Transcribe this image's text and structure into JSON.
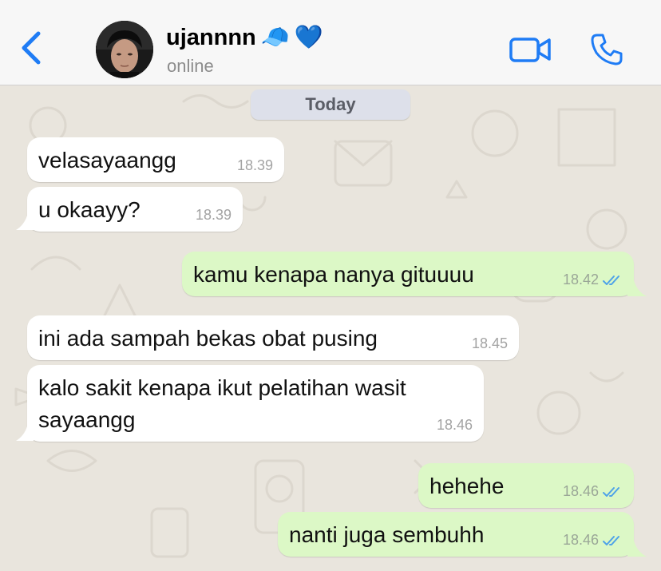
{
  "header": {
    "contact_name": "ujannnn",
    "status": "online",
    "emoji_cap": "🧢",
    "emoji_heart": "💙"
  },
  "chat": {
    "date_label": "Today",
    "messages": [
      {
        "dir": "in",
        "text": "velasayaangg",
        "time": "18.39"
      },
      {
        "dir": "in",
        "text": "u okaayy?",
        "time": "18.39"
      },
      {
        "dir": "out",
        "text": "kamu kenapa nanya gituuuu",
        "time": "18.42",
        "status": "read"
      },
      {
        "dir": "in",
        "text": "ini ada sampah bekas obat pusing",
        "time": "18.45"
      },
      {
        "dir": "in",
        "text": "kalo sakit kenapa ikut pelatihan wasit sayaangg",
        "time": "18.46"
      },
      {
        "dir": "out",
        "text": "hehehe",
        "time": "18.46",
        "status": "read"
      },
      {
        "dir": "out",
        "text": "nanti juga sembuhh",
        "time": "18.46",
        "status": "read"
      }
    ]
  },
  "colors": {
    "accent": "#1f7cf5",
    "incoming_bubble": "#ffffff",
    "outgoing_bubble": "#dcf8c6",
    "read_ticks": "#4fa3e8",
    "wallpaper": "#e9e5dd"
  }
}
